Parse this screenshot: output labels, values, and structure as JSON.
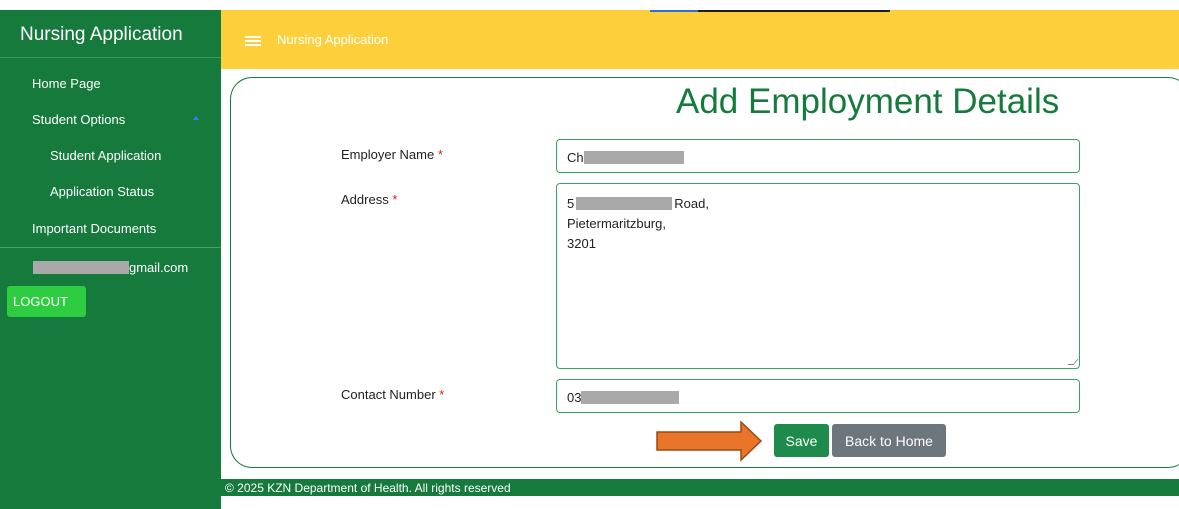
{
  "sidebar": {
    "title": "Nursing Application",
    "items": [
      {
        "label": "Home Page"
      },
      {
        "label": "Student Options"
      },
      {
        "label": "Student Application"
      },
      {
        "label": "Application Status"
      },
      {
        "label": "Important Documents"
      }
    ],
    "user_email_suffix": "gmail.com",
    "logout_label": "LOGOUT"
  },
  "topbar": {
    "title": "Nursing Application",
    "menu_icon": "hamburger-menu-icon"
  },
  "form": {
    "title": "Add Employment Details",
    "required_marker": "*",
    "employer_name": {
      "label": "Employer Name",
      "value_visible": "Ch"
    },
    "address": {
      "label": "Address",
      "line1_prefix": "5",
      "line1_suffix": "Road,",
      "line2": "Pietermaritzburg,",
      "line3": "3201"
    },
    "contact_number": {
      "label": "Contact Number",
      "value_visible": "03"
    },
    "save_label": "Save",
    "back_label": "Back to Home"
  },
  "footer": {
    "text": "© 2025 KZN Department of Health. All rights reserved"
  },
  "colors": {
    "sidebar_bg": "#157a3c",
    "topbar_bg": "#fdd03b",
    "accent_green": "#157a3c",
    "logout_bg": "#2ecc40",
    "save_bg": "#1e8a4c",
    "back_bg": "#6d757d",
    "arrow_fill": "#e8752a",
    "required": "#e02020"
  }
}
